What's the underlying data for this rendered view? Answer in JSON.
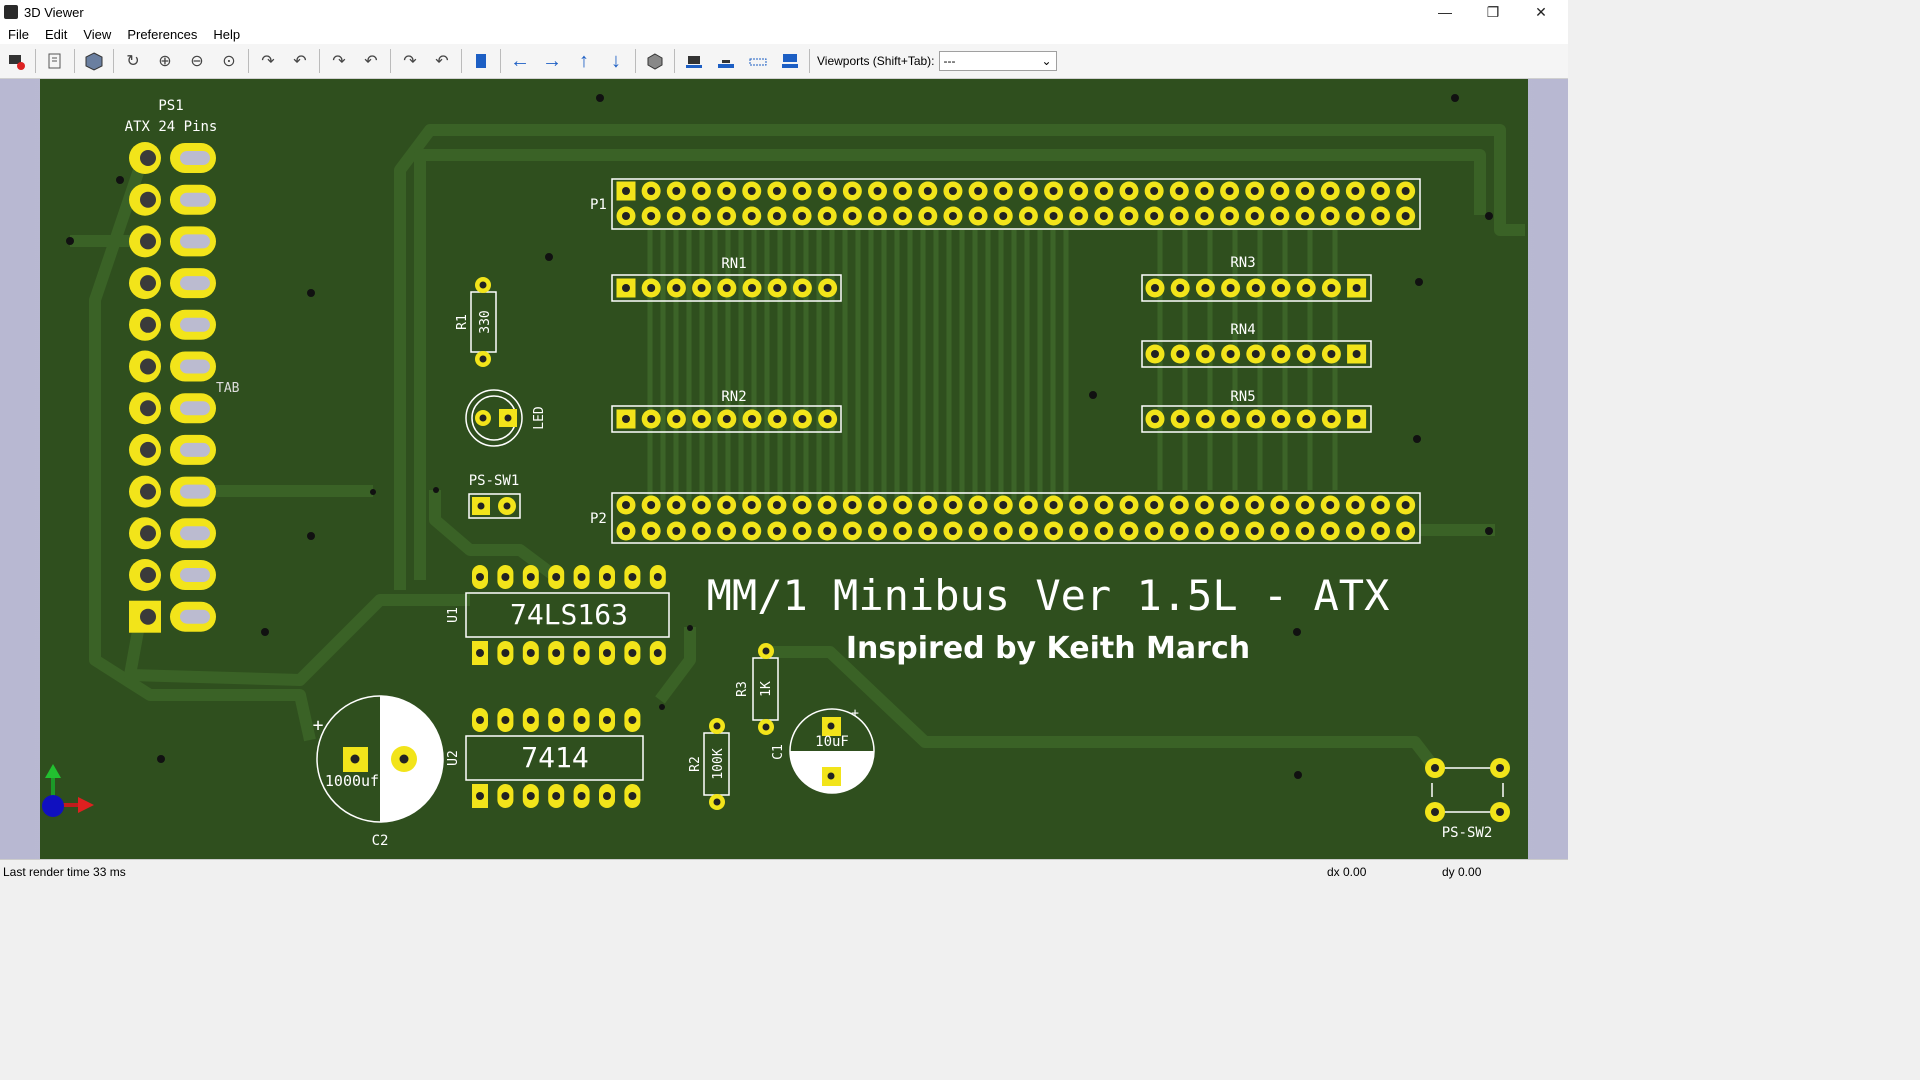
{
  "window": {
    "title": "3D Viewer",
    "minimize": "—",
    "restore": "❐",
    "close": "✕"
  },
  "menu": [
    "File",
    "Edit",
    "View",
    "Preferences",
    "Help"
  ],
  "toolbar": {
    "viewports_label": "Viewports (Shift+Tab):",
    "viewports_value": "---",
    "icons": [
      "render-icon",
      "copy-icon",
      "view-3d-icon",
      "refresh-icon",
      "zoom-in-icon",
      "zoom-out-icon",
      "zoom-fit-icon",
      "rotate-x-cw-icon",
      "rotate-x-ccw-icon",
      "rotate-y-cw-icon",
      "rotate-y-ccw-icon",
      "rotate-z-cw-icon",
      "rotate-z-ccw-icon",
      "flip-board-icon",
      "pan-left-icon",
      "pan-right-icon",
      "pan-up-icon",
      "pan-down-icon",
      "ortho-icon",
      "board-body-icon",
      "board-edge-icon",
      "silkscreen-icon",
      "smd-icon"
    ]
  },
  "board": {
    "ps1_ref": "PS1",
    "ps1_value": "ATX 24 Pins",
    "tab_label": "TAB",
    "p1": "P1",
    "p2": "P2",
    "rn1": "RN1",
    "rn2": "RN2",
    "rn3": "RN3",
    "rn4": "RN4",
    "rn5": "RN5",
    "r1": "R1",
    "r1_value": "330",
    "led": "LED",
    "ps_sw1": "PS-SW1",
    "u1": "U1",
    "u1_value": "74LS163",
    "u2": "U2",
    "u2_value": "7414",
    "r2": "R2",
    "r2_value": "100K",
    "r3": "R3",
    "r3_value": "1K",
    "c1": "C1",
    "c1_value": "10uF",
    "c2": "C2",
    "c2_value": "1000uf",
    "ps_sw2": "PS-SW2",
    "title": "MM/1 Minibus Ver 1.5L - ATX",
    "subtitle": "Inspired by Keith March",
    "plus": "+",
    "board_color": "#2f4f1e",
    "pad_color": "#f2e41a"
  },
  "status": {
    "render": "Last render time 33 ms",
    "dx": "dx 0.00",
    "dy": "dy 0.00"
  }
}
